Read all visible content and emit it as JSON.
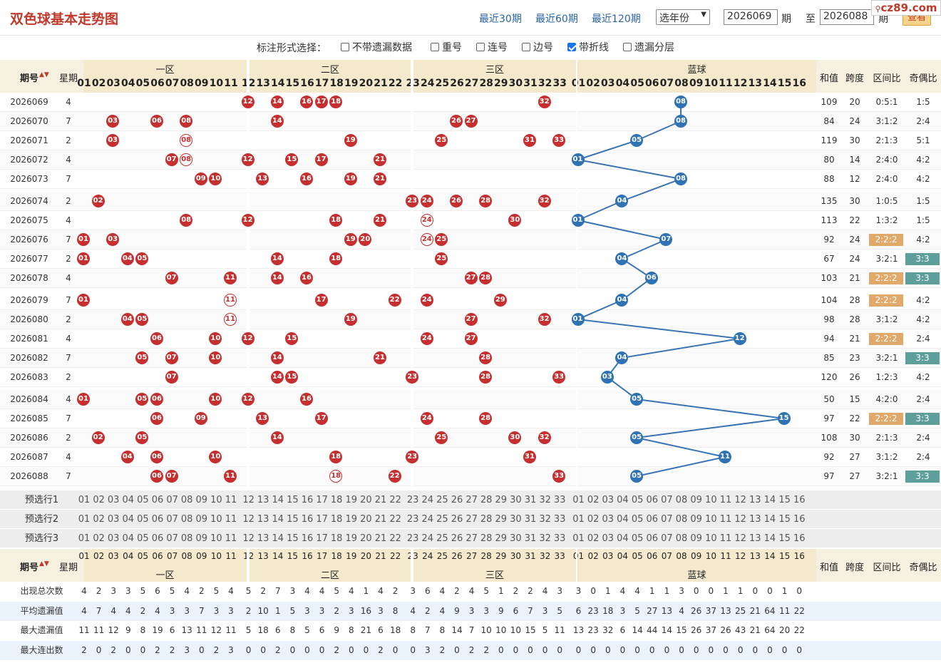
{
  "header": {
    "title": "双色球基本走势图",
    "recent30": "最近30期",
    "recent60": "最近60期",
    "recent120": "最近120期",
    "year_select": "选年份",
    "from_issue": "2026069",
    "issue_unit": "期",
    "to_label": "至",
    "to_issue": "2026088",
    "query_button": "查看",
    "watermark": "cz89.com"
  },
  "options": {
    "label": "标注形式选择：",
    "items": [
      {
        "label": "不带遗漏数据",
        "checked": false
      },
      {
        "label": "重号",
        "checked": false
      },
      {
        "label": "连号",
        "checked": false
      },
      {
        "label": "边号",
        "checked": false
      },
      {
        "label": "带折线",
        "checked": true
      },
      {
        "label": "遗漏分层",
        "checked": false
      }
    ]
  },
  "columns": {
    "issue": "期号",
    "week": "星期",
    "zones": [
      "一区",
      "二区",
      "三区",
      "蓝球"
    ],
    "sum": "和值",
    "span": "跨度",
    "zone_ratio": "区间比",
    "odd_even": "奇偶比"
  },
  "numbers_red": [
    "01",
    "02",
    "03",
    "04",
    "05",
    "06",
    "07",
    "08",
    "09",
    "10",
    "11",
    "12",
    "13",
    "14",
    "15",
    "16",
    "17",
    "18",
    "19",
    "20",
    "21",
    "22",
    "23",
    "24",
    "25",
    "26",
    "27",
    "28",
    "29",
    "30",
    "31",
    "32",
    "33"
  ],
  "numbers_blue": [
    "01",
    "02",
    "03",
    "04",
    "05",
    "06",
    "07",
    "08",
    "09",
    "10",
    "11",
    "12",
    "13",
    "14",
    "15",
    "16"
  ],
  "draws": [
    {
      "issue": "2026069",
      "week": "4",
      "red": [
        12,
        14,
        16,
        17,
        18,
        32
      ],
      "blue": 8,
      "sum": "109",
      "span": "20",
      "ratio": "0:5:1",
      "oe": "1:5",
      "ratio_hl": false,
      "oe_hl": false
    },
    {
      "issue": "2026070",
      "week": "7",
      "red": [
        3,
        6,
        8,
        14,
        26,
        27
      ],
      "blue": 8,
      "sum": "84",
      "span": "24",
      "ratio": "3:1:2",
      "oe": "2:4",
      "ratio_hl": false,
      "oe_hl": false
    },
    {
      "issue": "2026071",
      "week": "2",
      "red": [
        3,
        8,
        19,
        25,
        31,
        33
      ],
      "blue": 5,
      "sum": "119",
      "span": "30",
      "ratio": "2:1:3",
      "oe": "5:1",
      "ratio_hl": false,
      "oe_hl": false
    },
    {
      "issue": "2026072",
      "week": "4",
      "red": [
        7,
        8,
        12,
        15,
        17,
        21
      ],
      "blue": 1,
      "sum": "80",
      "span": "14",
      "ratio": "2:4:0",
      "oe": "4:2",
      "ratio_hl": false,
      "oe_hl": false
    },
    {
      "issue": "2026073",
      "week": "7",
      "red": [
        9,
        10,
        13,
        16,
        19,
        21
      ],
      "blue": 8,
      "sum": "88",
      "span": "12",
      "ratio": "2:4:0",
      "oe": "4:2",
      "ratio_hl": false,
      "oe_hl": false
    },
    {
      "issue": "2026074",
      "week": "2",
      "red": [
        2,
        23,
        24,
        26,
        28,
        32
      ],
      "blue": 4,
      "sum": "135",
      "span": "30",
      "ratio": "1:0:5",
      "oe": "1:5",
      "ratio_hl": false,
      "oe_hl": false
    },
    {
      "issue": "2026075",
      "week": "4",
      "red": [
        8,
        12,
        18,
        21,
        24,
        30
      ],
      "blue": 1,
      "sum": "113",
      "span": "22",
      "ratio": "1:3:2",
      "oe": "1:5",
      "ratio_hl": false,
      "oe_hl": false
    },
    {
      "issue": "2026076",
      "week": "7",
      "red": [
        1,
        3,
        19,
        20,
        24,
        25
      ],
      "blue": 7,
      "sum": "92",
      "span": "24",
      "ratio": "2:2:2",
      "oe": "4:2",
      "ratio_hl": true,
      "oe_hl": false
    },
    {
      "issue": "2026077",
      "week": "2",
      "red": [
        1,
        4,
        5,
        14,
        18,
        25
      ],
      "blue": 4,
      "sum": "67",
      "span": "24",
      "ratio": "3:2:1",
      "oe": "3:3",
      "ratio_hl": false,
      "oe_hl": true
    },
    {
      "issue": "2026078",
      "week": "4",
      "red": [
        7,
        11,
        14,
        16,
        27,
        28
      ],
      "blue": 6,
      "sum": "103",
      "span": "21",
      "ratio": "2:2:2",
      "oe": "3:3",
      "ratio_hl": true,
      "oe_hl": true
    },
    {
      "issue": "2026079",
      "week": "7",
      "red": [
        1,
        11,
        17,
        22,
        24,
        29
      ],
      "blue": 4,
      "sum": "104",
      "span": "28",
      "ratio": "2:2:2",
      "oe": "4:2",
      "ratio_hl": true,
      "oe_hl": false
    },
    {
      "issue": "2026080",
      "week": "2",
      "red": [
        4,
        5,
        11,
        19,
        27,
        32
      ],
      "blue": 1,
      "sum": "98",
      "span": "28",
      "ratio": "3:1:2",
      "oe": "4:2",
      "ratio_hl": false,
      "oe_hl": false
    },
    {
      "issue": "2026081",
      "week": "4",
      "red": [
        6,
        10,
        12,
        15,
        24,
        27
      ],
      "blue": 12,
      "sum": "94",
      "span": "21",
      "ratio": "2:2:2",
      "oe": "2:4",
      "ratio_hl": true,
      "oe_hl": false
    },
    {
      "issue": "2026082",
      "week": "7",
      "red": [
        5,
        7,
        10,
        14,
        21,
        28
      ],
      "blue": 4,
      "sum": "85",
      "span": "23",
      "ratio": "3:2:1",
      "oe": "3:3",
      "ratio_hl": false,
      "oe_hl": true
    },
    {
      "issue": "2026083",
      "week": "2",
      "red": [
        7,
        14,
        15,
        23,
        28,
        33
      ],
      "blue": 3,
      "sum": "120",
      "span": "26",
      "ratio": "1:2:3",
      "oe": "4:2",
      "ratio_hl": false,
      "oe_hl": false
    },
    {
      "issue": "2026084",
      "week": "4",
      "red": [
        1,
        5,
        6,
        10,
        12,
        16
      ],
      "blue": 5,
      "sum": "50",
      "span": "15",
      "ratio": "4:2:0",
      "oe": "2:4",
      "ratio_hl": false,
      "oe_hl": false
    },
    {
      "issue": "2026085",
      "week": "7",
      "red": [
        6,
        9,
        13,
        17,
        24,
        28
      ],
      "blue": 15,
      "sum": "97",
      "span": "22",
      "ratio": "2:2:2",
      "oe": "3:3",
      "ratio_hl": true,
      "oe_hl": true
    },
    {
      "issue": "2026086",
      "week": "2",
      "red": [
        2,
        5,
        14,
        25,
        30,
        32
      ],
      "blue": 5,
      "sum": "108",
      "span": "30",
      "ratio": "2:1:3",
      "oe": "2:4",
      "ratio_hl": false,
      "oe_hl": false
    },
    {
      "issue": "2026087",
      "week": "4",
      "red": [
        4,
        6,
        10,
        18,
        23,
        31
      ],
      "blue": 11,
      "sum": "92",
      "span": "27",
      "ratio": "3:1:2",
      "oe": "2:4",
      "ratio_hl": false,
      "oe_hl": false
    },
    {
      "issue": "2026088",
      "week": "7",
      "red": [
        6,
        7,
        11,
        18,
        22,
        33
      ],
      "blue": 5,
      "sum": "97",
      "span": "27",
      "ratio": "3:2:1",
      "oe": "3:3",
      "ratio_hl": false,
      "oe_hl": true
    }
  ],
  "preselect": [
    "预选行1",
    "预选行2",
    "预选行3"
  ],
  "stats": [
    {
      "label": "出现总次数",
      "red": [
        "4",
        "2",
        "3",
        "3",
        "5",
        "6",
        "5",
        "4",
        "2",
        "5",
        "4",
        "5",
        "2",
        "7",
        "3",
        "4",
        "4",
        "5",
        "4",
        "1",
        "4",
        "2",
        "3",
        "6",
        "4",
        "2",
        "4",
        "5",
        "1",
        "2",
        "2",
        "4",
        "3"
      ],
      "blue": [
        "3",
        "0",
        "1",
        "4",
        "4",
        "1",
        "1",
        "3",
        "0",
        "0",
        "1",
        "1",
        "0",
        "0",
        "1",
        "0"
      ]
    },
    {
      "label": "平均遗漏值",
      "red": [
        "4",
        "7",
        "4",
        "4",
        "2",
        "4",
        "3",
        "3",
        "7",
        "3",
        "3",
        "2",
        "10",
        "1",
        "5",
        "3",
        "3",
        "2",
        "3",
        "16",
        "3",
        "8",
        "4",
        "2",
        "4",
        "9",
        "3",
        "3",
        "9",
        "6",
        "7",
        "3",
        "5"
      ],
      "blue": [
        "6",
        "23",
        "18",
        "3",
        "5",
        "27",
        "13",
        "4",
        "26",
        "37",
        "13",
        "25",
        "21",
        "64",
        "11",
        "22"
      ]
    },
    {
      "label": "最大遗漏值",
      "red": [
        "11",
        "11",
        "12",
        "9",
        "8",
        "19",
        "6",
        "13",
        "11",
        "12",
        "11",
        "5",
        "18",
        "6",
        "8",
        "5",
        "6",
        "9",
        "8",
        "21",
        "6",
        "18",
        "8",
        "7",
        "8",
        "14",
        "7",
        "10",
        "10",
        "10",
        "15",
        "5",
        "11"
      ],
      "blue": [
        "13",
        "23",
        "32",
        "6",
        "14",
        "44",
        "14",
        "15",
        "26",
        "37",
        "26",
        "43",
        "21",
        "64",
        "20",
        "22"
      ]
    },
    {
      "label": "最大连出数",
      "red": [
        "2",
        "0",
        "2",
        "0",
        "0",
        "2",
        "2",
        "3",
        "0",
        "2",
        "3",
        "0",
        "0",
        "2",
        "0",
        "0",
        "0",
        "2",
        "0",
        "0",
        "2",
        "0",
        "0",
        "3",
        "2",
        "0",
        "2",
        "2",
        "0",
        "0",
        "0",
        "0",
        "0"
      ],
      "blue": [
        "0",
        "0",
        "0",
        "0",
        "0",
        "0",
        "0",
        "0",
        "0",
        "0",
        "0",
        "0",
        "0",
        "0",
        "0",
        "0"
      ]
    }
  ]
}
